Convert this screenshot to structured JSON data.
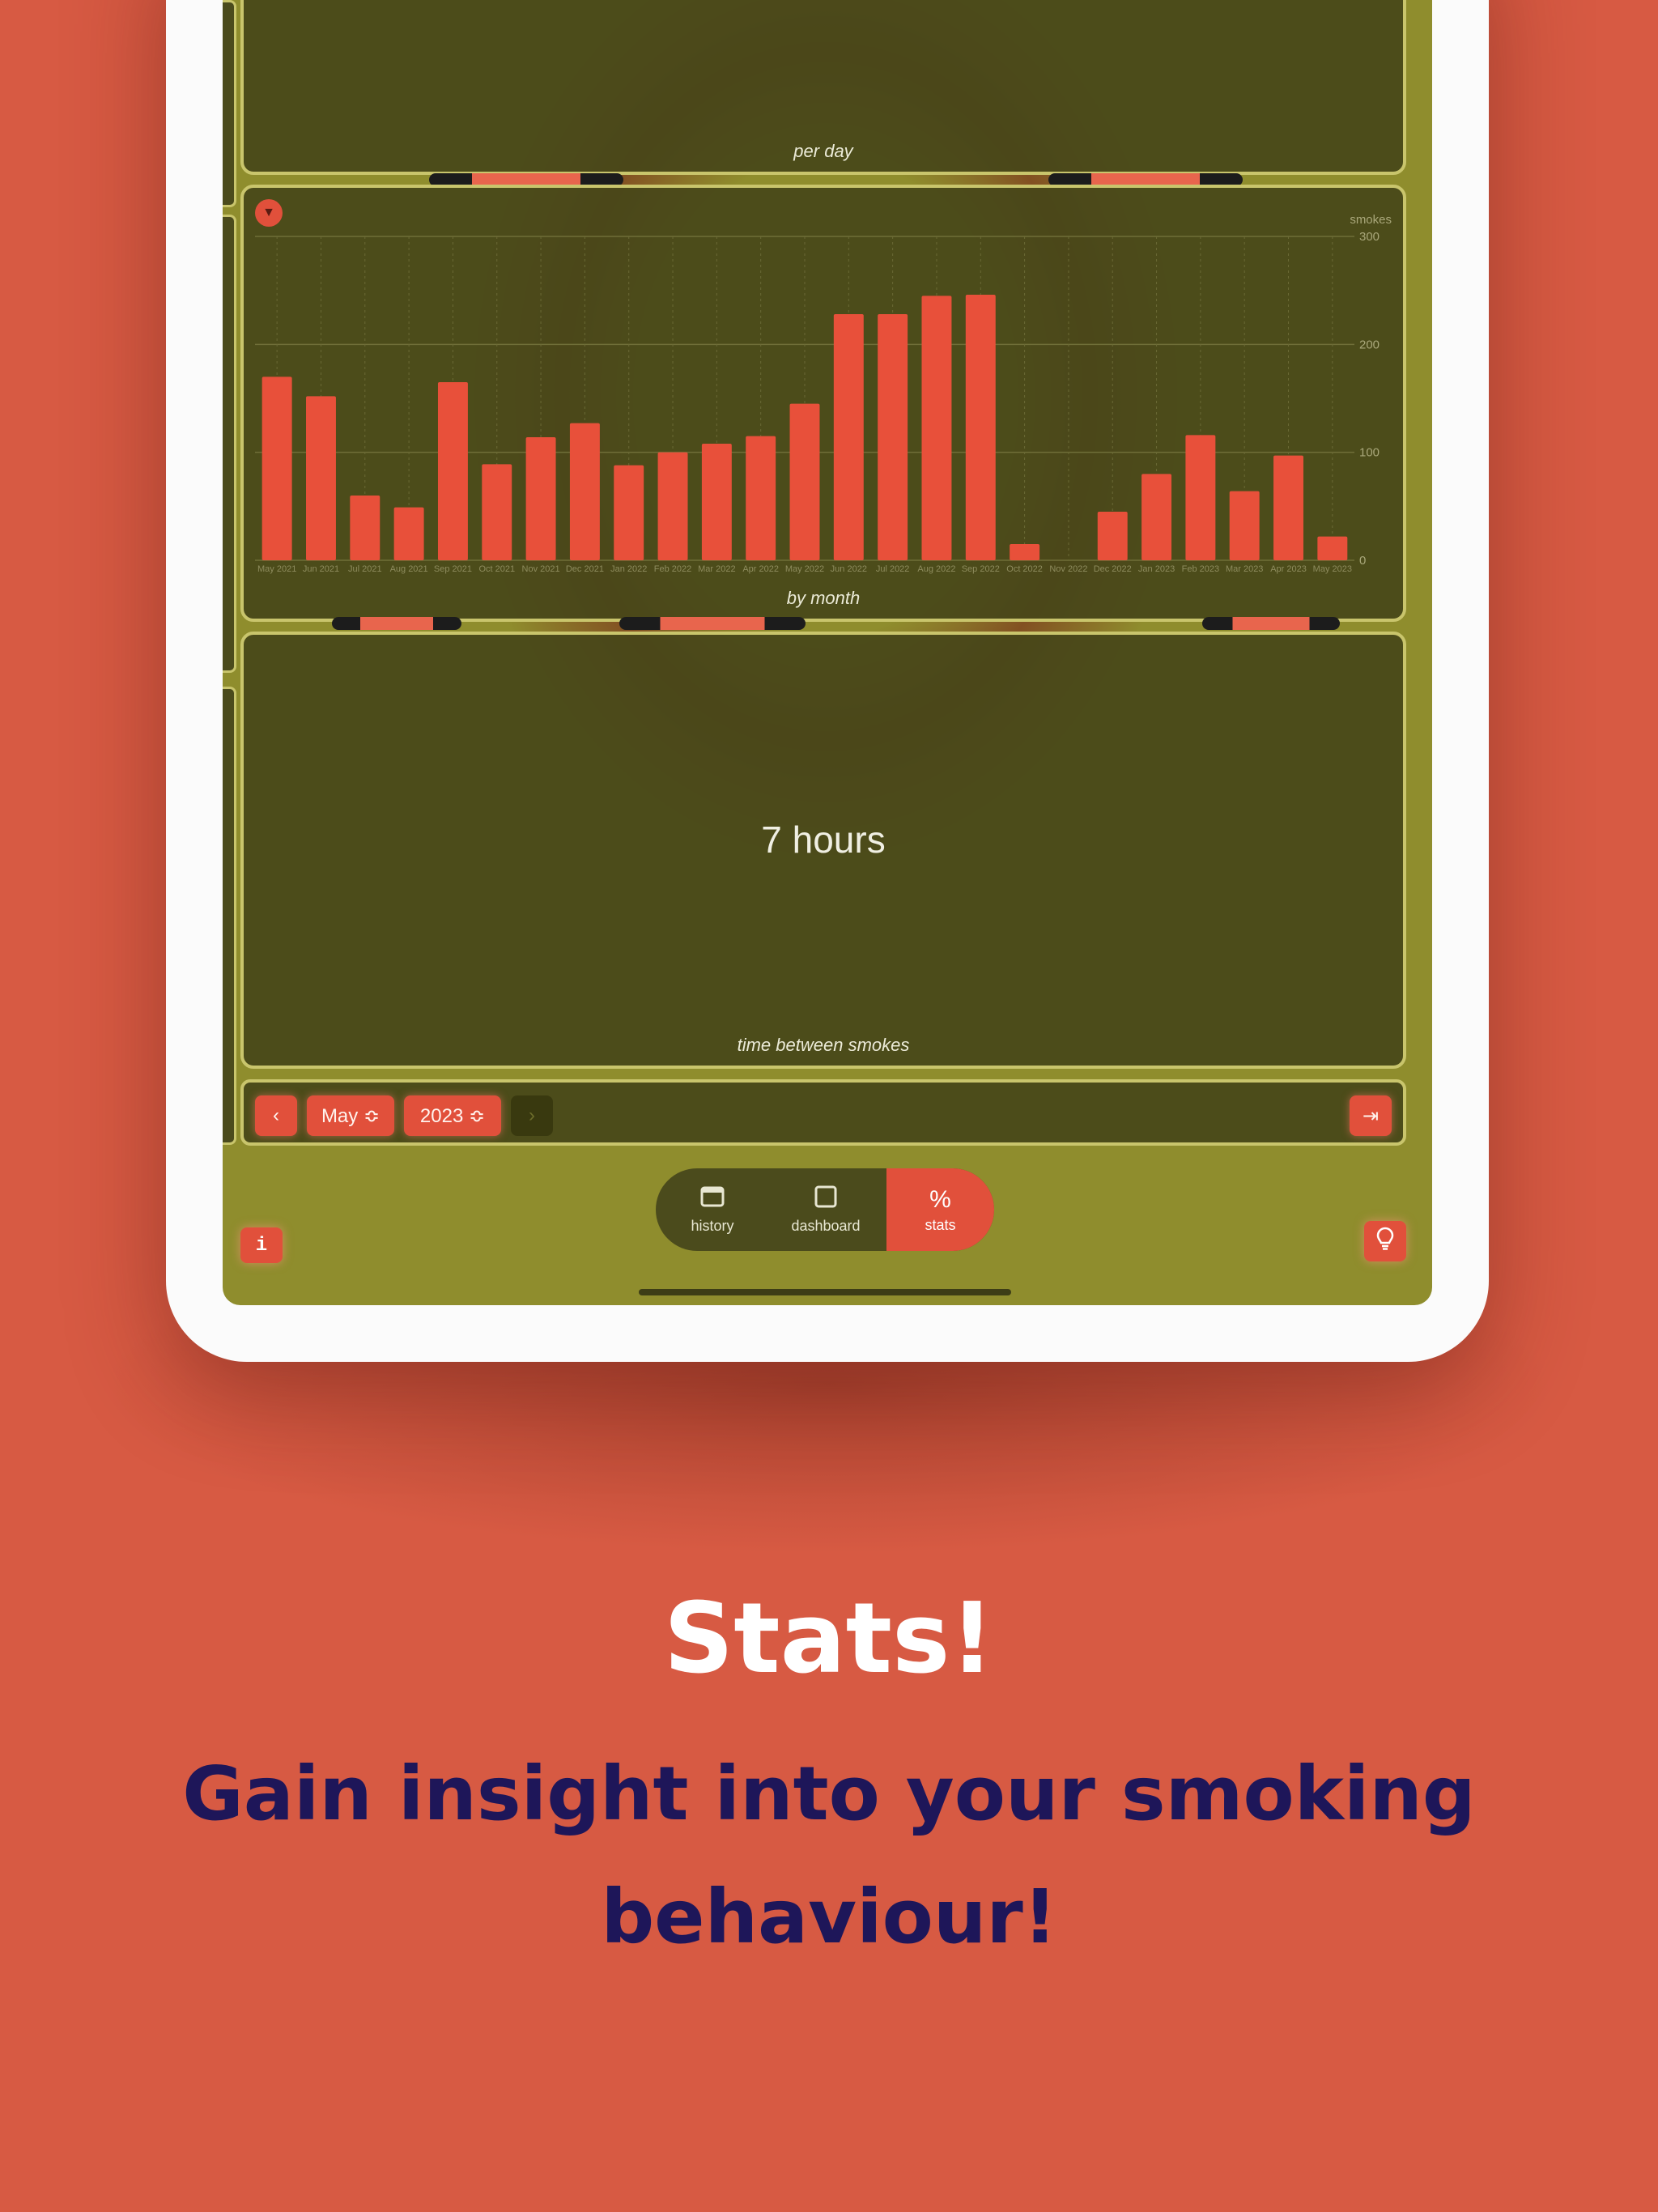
{
  "colors": {
    "page_background": "#d75a43",
    "screen_background": "#8f8d2d",
    "panel_background": "#46461a",
    "panel_border": "#c9c56c",
    "accent": "#e1503b",
    "headline_sub": "#1e1659"
  },
  "panels": {
    "per_day_caption": "per day",
    "by_month_caption": "by month",
    "time_between_value": "7 hours",
    "time_between_caption": "time between smokes"
  },
  "chart_data": {
    "type": "bar",
    "title": "",
    "xlabel": "",
    "ylabel": "smokes",
    "ylim": [
      0,
      300
    ],
    "yticks": [
      0,
      100,
      200,
      300
    ],
    "grid": true,
    "categories": [
      "May 2021",
      "Jun 2021",
      "Jul 2021",
      "Aug 2021",
      "Sep 2021",
      "Oct 2021",
      "Nov 2021",
      "Dec 2021",
      "Jan 2022",
      "Feb 2022",
      "Mar 2022",
      "Apr 2022",
      "May 2022",
      "Jun 2022",
      "Jul 2022",
      "Aug 2022",
      "Sep 2022",
      "Oct 2022",
      "Nov 2022",
      "Dec 2022",
      "Jan 2023",
      "Feb 2023",
      "Mar 2023",
      "Apr 2023",
      "May 2023"
    ],
    "values": [
      170,
      152,
      60,
      49,
      165,
      89,
      114,
      127,
      88,
      100,
      108,
      115,
      145,
      228,
      228,
      245,
      246,
      15,
      0,
      45,
      80,
      116,
      64,
      97,
      22
    ]
  },
  "navigation": {
    "prev_icon": "chevron-left-icon",
    "month": "May ≎",
    "year": "2023 ≎",
    "next_icon": "chevron-right-icon",
    "latest_icon": "skip-to-end-icon"
  },
  "tabbar": {
    "tabs": [
      {
        "label": "history",
        "icon": "calendar-icon"
      },
      {
        "label": "dashboard",
        "icon": "square-icon"
      },
      {
        "label": "stats",
        "icon": "percent-icon",
        "glyph": "%"
      }
    ],
    "active": "stats"
  },
  "corner_buttons": {
    "info_glyph": "i",
    "tip_icon": "lightbulb-icon"
  },
  "headline": {
    "title": "Stats!",
    "subtitle_line1": "Gain insight into your smoking",
    "subtitle_line2": "behaviour!"
  }
}
